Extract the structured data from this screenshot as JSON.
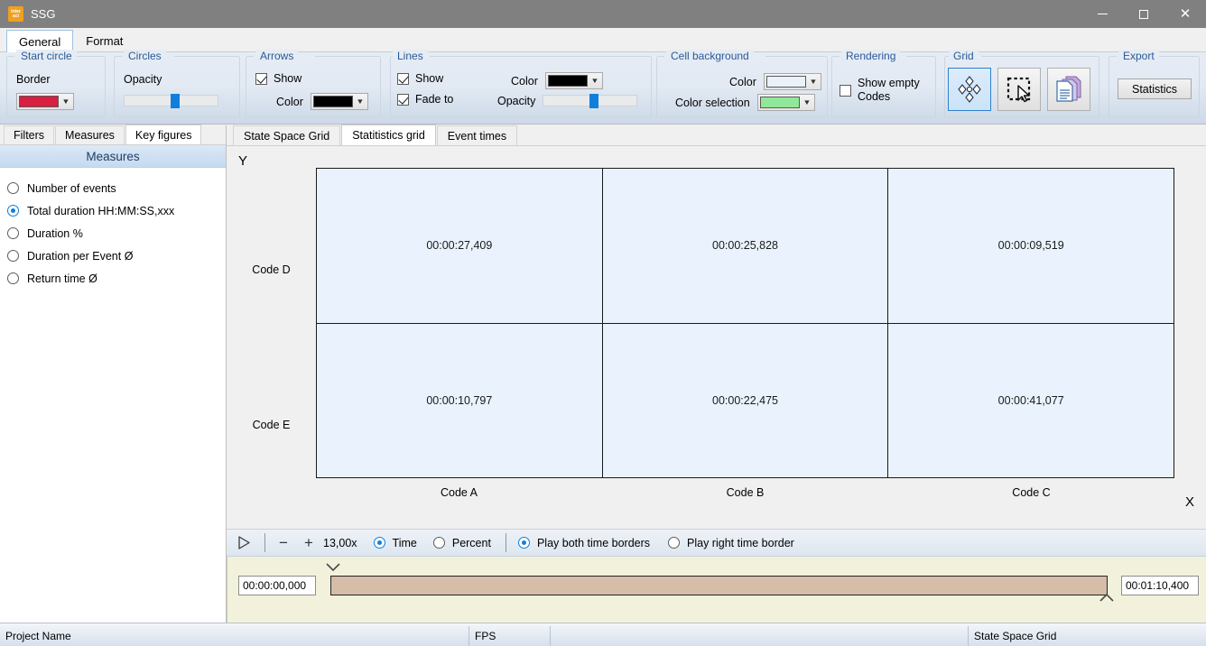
{
  "window": {
    "title": "SSG",
    "logo_text_top": "inter",
    "logo_text_bottom": "act",
    "minimize_label": "Minimize",
    "maximize_label": "Maximize",
    "close_label": "Close"
  },
  "ribbon": {
    "tabs": [
      {
        "label": "General",
        "active": true
      },
      {
        "label": "Format",
        "active": false
      }
    ],
    "groups": {
      "start_circle": {
        "title": "Start circle",
        "border_label": "Border",
        "border_color": "#d81e41"
      },
      "circles": {
        "title": "Circles",
        "opacity_label": "Opacity",
        "opacity_value": 55
      },
      "arrows": {
        "title": "Arrows",
        "show_label": "Show",
        "show_checked": true,
        "color_label": "Color",
        "color_value": "#000000"
      },
      "lines": {
        "title": "Lines",
        "show_label": "Show",
        "show_checked": true,
        "fade_label": "Fade to",
        "fade_checked": true,
        "color_label": "Color",
        "color_value": "#000000",
        "opacity_label": "Opacity",
        "opacity_value": 55
      },
      "cell_background": {
        "title": "Cell background",
        "color_label": "Color",
        "color_value": "#eaf1fb",
        "selection_label": "Color selection",
        "selection_value": "#90e89a"
      },
      "rendering": {
        "title": "Rendering",
        "show_empty_label": "Show empty Codes",
        "show_empty_checked": false
      },
      "grid": {
        "title": "Grid",
        "buttons": [
          {
            "name": "state-space-grid-view",
            "selected": true
          },
          {
            "name": "selection-tool",
            "selected": false
          },
          {
            "name": "copy-documents",
            "selected": false
          }
        ]
      },
      "export": {
        "title": "Export",
        "statistics_label": "Statistics"
      }
    }
  },
  "sidebar": {
    "tabs": [
      {
        "label": "Filters",
        "active": false
      },
      {
        "label": "Measures",
        "active": false
      },
      {
        "label": "Key figures",
        "active": true
      }
    ],
    "header": "Measures",
    "measures": [
      {
        "label": "Number of events",
        "selected": false
      },
      {
        "label": "Total duration HH:MM:SS,xxx",
        "selected": true
      },
      {
        "label": "Duration %",
        "selected": false
      },
      {
        "label": "Duration per Event Ø",
        "selected": false
      },
      {
        "label": "Return time Ø",
        "selected": false
      }
    ]
  },
  "content": {
    "tabs": [
      {
        "label": "State Space Grid",
        "active": false
      },
      {
        "label": "Statitistics grid",
        "active": true
      },
      {
        "label": "Event times",
        "active": false
      }
    ],
    "axis_y_label": "Y",
    "axis_x_label": "X"
  },
  "chart_data": {
    "type": "heatmap",
    "title": "",
    "xlabel": "X",
    "ylabel": "Y",
    "x_categories": [
      "Code A",
      "Code B",
      "Code C"
    ],
    "y_categories": [
      "Code D",
      "Code E"
    ],
    "value_format": "HH:MM:SS,xxx",
    "cells": [
      [
        "00:00:27,409",
        "00:00:25,828",
        "00:00:09,519"
      ],
      [
        "00:00:10,797",
        "00:00:22,475",
        "00:00:41,077"
      ]
    ],
    "cell_color": "#eaf3fd",
    "border_color": "#1a1a1a",
    "grid": true,
    "legend": "none"
  },
  "player": {
    "play_label": "Play",
    "zoom_out_label": "−",
    "zoom_in_label": "+",
    "zoom_value": "13,00x",
    "mode_options": [
      {
        "label": "Time",
        "selected": true
      },
      {
        "label": "Percent",
        "selected": false
      }
    ],
    "border_options": [
      {
        "label": "Play both time borders",
        "selected": true
      },
      {
        "label": "Play right time border",
        "selected": false
      }
    ]
  },
  "timeline": {
    "start_time": "00:00:00,000",
    "end_time": "00:01:10,400",
    "bar_color": "#d5bda8",
    "left_marker": "chevron-down",
    "right_marker": "chevron-up"
  },
  "statusbar": {
    "project_name": "Project Name",
    "fps_label": "FPS",
    "empty_label": "",
    "view_label": "State Space Grid"
  }
}
